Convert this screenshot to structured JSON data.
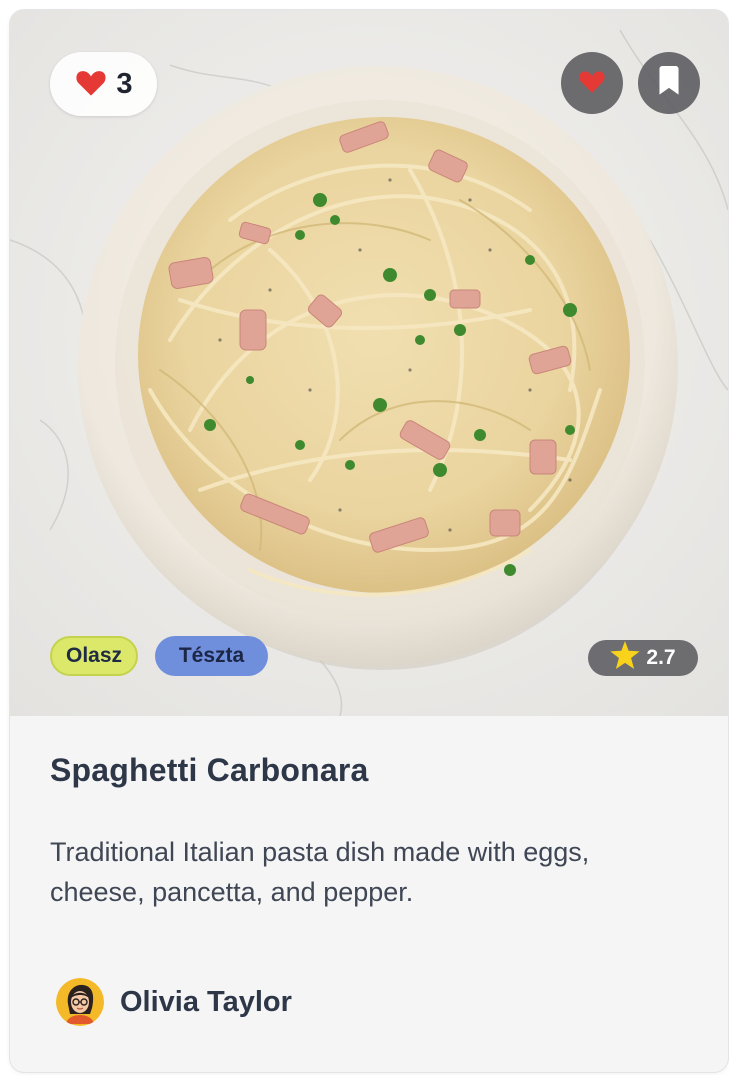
{
  "recipe": {
    "likes": "3",
    "tags": [
      "Olasz",
      "Tészta"
    ],
    "rating": "2.7",
    "title": "Spaghetti Carbonara",
    "description": "Traditional Italian pasta dish made with eggs, cheese, pancetta, and pepper.",
    "author": "Olivia Taylor"
  },
  "icons": {
    "like": "heart-icon",
    "favorite": "heart-icon",
    "bookmark": "bookmark-icon",
    "rating": "star-icon"
  },
  "colors": {
    "heart": "#e53935",
    "star": "#f9d21c",
    "tag_olasz": "#dbe86a",
    "tag_teszta": "#6f8fdc",
    "title": "#2d3748"
  }
}
